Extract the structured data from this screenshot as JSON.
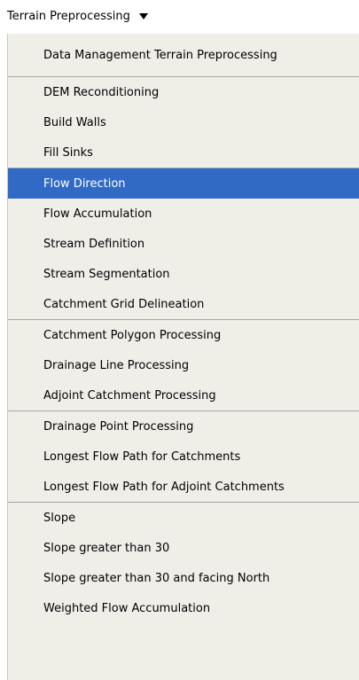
{
  "menubar": {
    "title": "Terrain Preprocessing"
  },
  "menu": {
    "groups": [
      {
        "items": [
          {
            "label": "Data Management Terrain Preprocessing"
          }
        ]
      },
      {
        "items": [
          {
            "label": "DEM Reconditioning"
          },
          {
            "label": "Build Walls"
          },
          {
            "label": "Fill Sinks"
          }
        ]
      },
      {
        "items": [
          {
            "label": "Flow Direction",
            "selected": true
          },
          {
            "label": "Flow Accumulation"
          },
          {
            "label": "Stream Definition"
          },
          {
            "label": "Stream Segmentation"
          },
          {
            "label": "Catchment Grid Delineation"
          }
        ]
      },
      {
        "items": [
          {
            "label": "Catchment Polygon Processing"
          },
          {
            "label": "Drainage Line Processing"
          },
          {
            "label": "Adjoint Catchment Processing"
          }
        ]
      },
      {
        "items": [
          {
            "label": "Drainage Point Processing"
          },
          {
            "label": "Longest Flow Path for Catchments"
          },
          {
            "label": "Longest Flow Path for Adjoint Catchments"
          }
        ]
      },
      {
        "items": [
          {
            "label": "Slope"
          },
          {
            "label": "Slope greater than 30"
          },
          {
            "label": "Slope greater than 30 and facing North"
          },
          {
            "label": "Weighted Flow Accumulation"
          }
        ]
      }
    ]
  },
  "colors": {
    "menu_bg": "#efeee7",
    "highlight": "#316ac5",
    "highlight_text": "#ffffff"
  },
  "icons": {
    "menubar_dropdown": "caret-down-icon"
  }
}
